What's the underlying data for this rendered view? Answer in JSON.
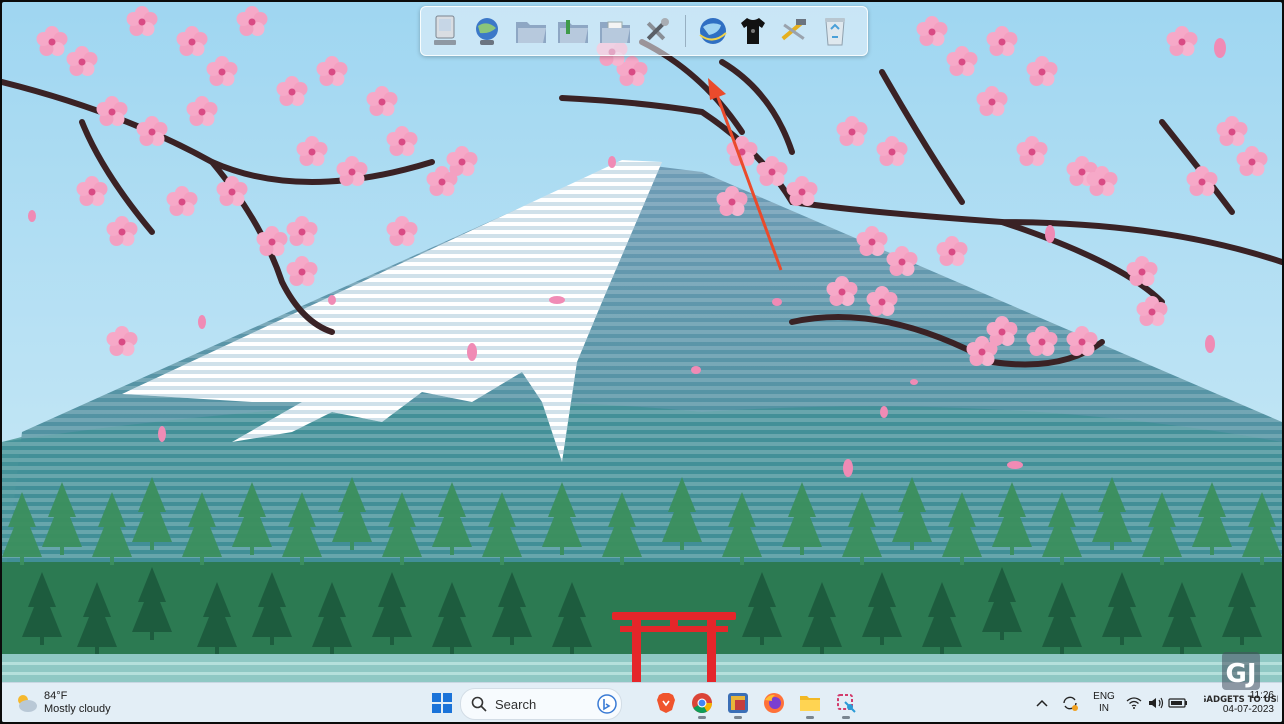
{
  "dock": {
    "items": [
      {
        "name": "computer-icon"
      },
      {
        "name": "network-globe-icon"
      },
      {
        "name": "folder-open-icon"
      },
      {
        "name": "folder-green-icon"
      },
      {
        "name": "folder-documents-icon"
      },
      {
        "name": "tools-settings-icon"
      },
      {
        "name": "internet-globe-icon"
      },
      {
        "name": "tshirt-icon"
      },
      {
        "name": "hammer-wrench-icon"
      },
      {
        "name": "recycle-bin-icon"
      }
    ]
  },
  "taskbar": {
    "weather": {
      "temp": "84°F",
      "condition": "Mostly cloudy"
    },
    "search_label": "Search",
    "apps": [
      {
        "name": "start-button"
      },
      {
        "name": "copilot-app"
      },
      {
        "name": "brave-browser-app"
      },
      {
        "name": "chrome-app"
      },
      {
        "name": "photos-app"
      },
      {
        "name": "firefox-app"
      },
      {
        "name": "file-explorer-app"
      },
      {
        "name": "snipping-tool-app"
      }
    ],
    "language": {
      "line1": "ENG",
      "line2": "IN"
    },
    "clock": {
      "time": "11:26",
      "date": "04-07-2023"
    }
  },
  "watermark": {
    "logo_text": "GJ",
    "brand": "GADGETS TO USE"
  },
  "colors": {
    "sky": "#a9dcf3",
    "blossom": "#f29bc0",
    "mountain": "#6f9fb2",
    "forest": "#1f6b48",
    "torii": "#e5262a",
    "arrow": "#ea4b2c",
    "taskbar": "#e3eef6"
  }
}
